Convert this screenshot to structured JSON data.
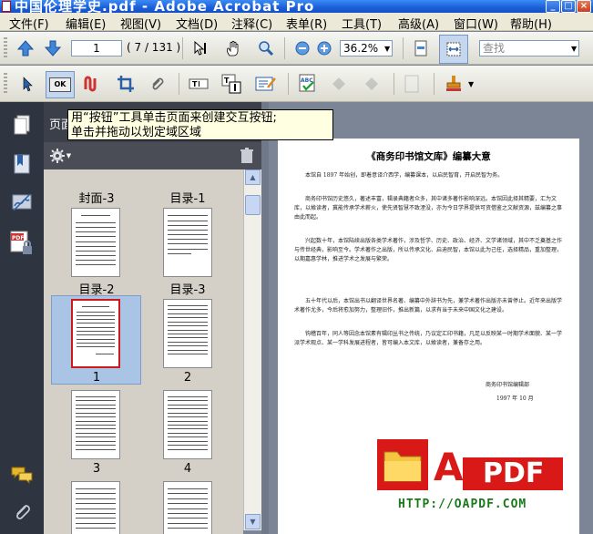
{
  "window": {
    "title": "中国伦理学史.pdf - Adobe Acrobat Pro"
  },
  "menu": [
    "文件(F)",
    "编辑(E)",
    "视图(V)",
    "文档(D)",
    "注释(C)",
    "表单(R)",
    "工具(T)",
    "高级(A)",
    "窗口(W)",
    "帮助(H)"
  ],
  "toolbar": {
    "page_number": "1",
    "page_count": "( 7 / 131 )",
    "zoom": "36.2%",
    "search_placeholder": "查找"
  },
  "tooltip": {
    "line1": "用“按钮”工具单击页面来创建交互按钮;",
    "line2": "单击并拖动以划定域区域"
  },
  "panel": {
    "title": "页面"
  },
  "thumbnails": [
    {
      "label": "封面-3"
    },
    {
      "label": "目录-1"
    },
    {
      "label": "目录-2"
    },
    {
      "label": "目录-3"
    },
    {
      "label": "1",
      "selected": true
    },
    {
      "label": "2"
    },
    {
      "label": "3"
    },
    {
      "label": "4"
    }
  ],
  "document": {
    "title": "《商务印书馆文库》编纂大意",
    "paragraphs": [
      "本馆自 1897 年始创，即着意译介西学，编纂课本，以启民智育，开启民智为务。",
      "商务印书馆历史悠久，著述丰富，辑录典籍者众多，其中诸多著作影响深远。本馆因此择其精要，汇为文库，以飨读者，冀能传承学术薪火，使先贤智慧不致湮没，亦为今日学界提供可资借鉴之文献资源，兹编纂之事由此而起。",
      "兴起数十年，本馆陆续出版各类学术著作，涉及哲学、历史、政治、经济、文学诸领域，其中不乏奠基之作与传世经典，影响至今。学术著作之出版，所以传承文化、启迪民智，本馆以此为己任，选择精品，重加整理，以期嘉惠学林，推进学术之发展与繁荣。",
      "五十年代以后，本馆出书以翻译世界名著、编纂中外辞书为先，兼学术著作出版亦未曾停止。近年来出版学术著作尤多，今后将愈加努力，整理旧作，推出新篇，以求有当于未来中国文化之建设。",
      "钩稽百年，同人等因念本馆素有辑印丛书之传统，乃议定汇印书籍，凡足以反映某一时期学术面貌、某一学派学术观点、某一学科发展进程者，皆可编入本文库，以飨读者，兼备存之用。"
    ],
    "signature": "商务印书馆编辑部",
    "date": "1997 年 10 月"
  },
  "watermark": {
    "letter": "A",
    "brand": "PDF",
    "url": "HTTP://OAPDF.COM"
  },
  "colors": {
    "accent": "#1b5fd8",
    "logo_red": "#d91818",
    "logo_folder": "#f5c542"
  }
}
